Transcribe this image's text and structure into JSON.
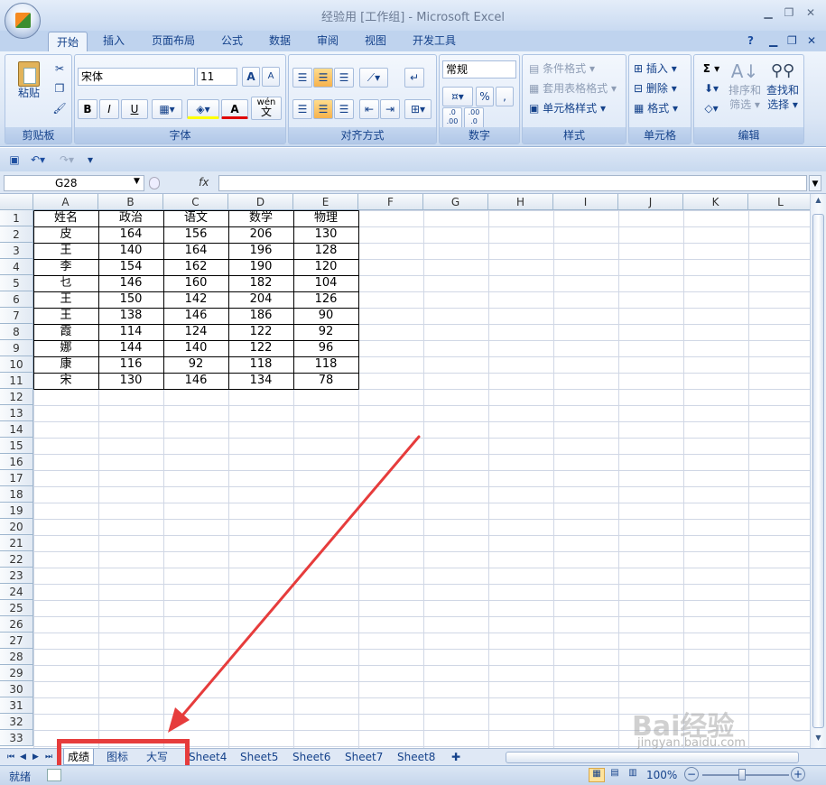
{
  "window": {
    "title": "经验用  [工作组] - Microsoft Excel"
  },
  "tabs": [
    "开始",
    "插入",
    "页面布局",
    "公式",
    "数据",
    "审阅",
    "视图",
    "开发工具"
  ],
  "ribbon": {
    "clipboard": {
      "paste": "粘贴",
      "label": "剪贴板"
    },
    "font": {
      "name": "宋体",
      "size": "11",
      "bold": "B",
      "italic": "I",
      "underline": "U",
      "color_a": "A",
      "phonetic": "wén",
      "phonetic2": "文",
      "grow": "A",
      "shrink": "A",
      "label": "字体"
    },
    "alignment": {
      "label": "对齐方式"
    },
    "number": {
      "format": "常规",
      "percent": "%",
      "comma": ",",
      "inc": ".0",
      "inc2": ".00",
      "dec": ".00",
      "dec2": ".0",
      "label": "数字"
    },
    "styles": {
      "conditional": "条件格式",
      "table": "套用表格格式",
      "cell": "单元格样式",
      "label": "样式"
    },
    "cells": {
      "insert": "插入",
      "delete": "删除",
      "format": "格式",
      "label": "单元格"
    },
    "editing": {
      "sigma": "Σ",
      "sort": "排序和",
      "sort2": "筛选",
      "find": "查找和",
      "find2": "选择",
      "label": "编辑"
    }
  },
  "formula_bar": {
    "name_box": "G28",
    "fx": "fx"
  },
  "columns": [
    "A",
    "B",
    "C",
    "D",
    "E",
    "F",
    "G",
    "H",
    "I",
    "J",
    "K",
    "L"
  ],
  "rows": [
    "1",
    "2",
    "3",
    "4",
    "5",
    "6",
    "7",
    "8",
    "9",
    "10",
    "11",
    "12",
    "13",
    "14",
    "15",
    "16",
    "17",
    "18",
    "19",
    "20",
    "21",
    "22",
    "23",
    "24",
    "25",
    "26",
    "27",
    "28",
    "29",
    "30",
    "31",
    "32",
    "33"
  ],
  "table": {
    "headers": [
      "姓名",
      "政治",
      "语文",
      "数学",
      "物理"
    ],
    "rows": [
      [
        "皮",
        "164",
        "156",
        "206",
        "130"
      ],
      [
        "王",
        "140",
        "164",
        "196",
        "128"
      ],
      [
        "李",
        "154",
        "162",
        "190",
        "120"
      ],
      [
        "乜",
        "146",
        "160",
        "182",
        "104"
      ],
      [
        "王",
        "150",
        "142",
        "204",
        "126"
      ],
      [
        "王",
        "138",
        "146",
        "186",
        "90"
      ],
      [
        "霞",
        "114",
        "124",
        "122",
        "92"
      ],
      [
        "娜",
        "144",
        "140",
        "122",
        "96"
      ],
      [
        "康",
        "116",
        "92",
        "118",
        "118"
      ],
      [
        "宋",
        "130",
        "146",
        "134",
        "78"
      ]
    ]
  },
  "sheets": [
    "成绩",
    "图标",
    "大写",
    "Sheet4",
    "Sheet5",
    "Sheet6",
    "Sheet7",
    "Sheet8"
  ],
  "status": {
    "ready": "就绪",
    "zoom": "100%"
  },
  "watermark": {
    "text": "Bai经验",
    "url": "jingyan.baidu.com"
  },
  "colors": {
    "annotation": "#e63c3c",
    "ribbon": "#dbe6f5",
    "grid_line": "#d0d7e5"
  }
}
